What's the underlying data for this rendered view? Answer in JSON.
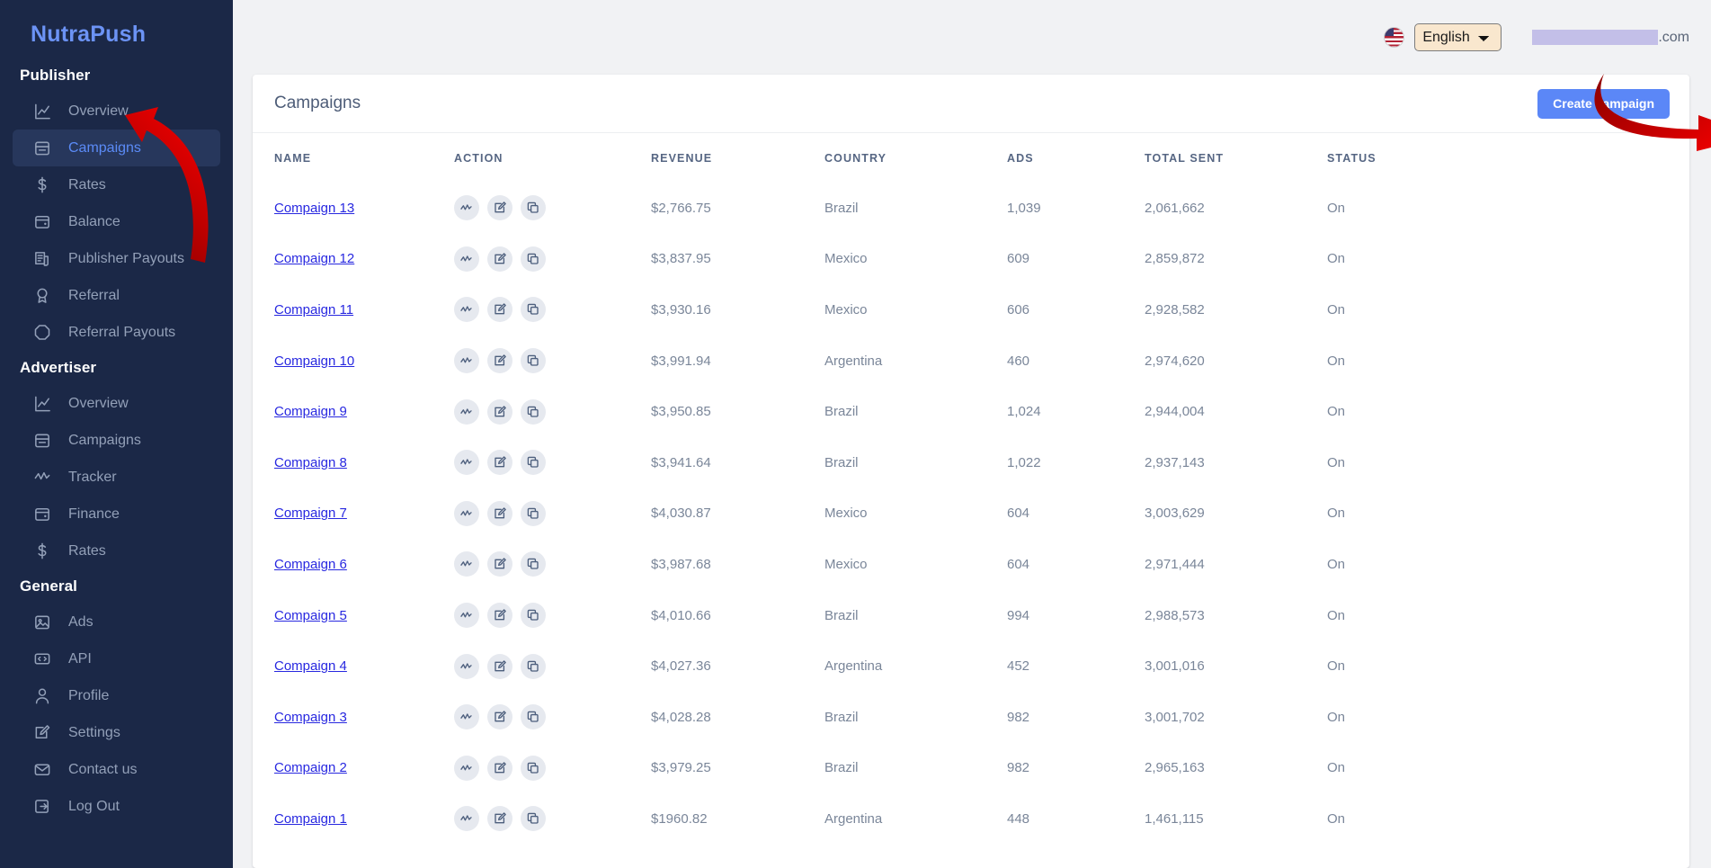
{
  "brand": {
    "name": "NutraPush"
  },
  "sidebar": {
    "sections": [
      {
        "title": "Publisher",
        "items": [
          {
            "label": "Overview",
            "icon": "chart-line-icon",
            "active": false
          },
          {
            "label": "Campaigns",
            "icon": "campaign-board-icon",
            "active": true
          },
          {
            "label": "Rates",
            "icon": "dollar-icon",
            "active": false
          },
          {
            "label": "Balance",
            "icon": "wallet-icon",
            "active": false
          },
          {
            "label": "Publisher Payouts",
            "icon": "invoice-icon",
            "active": false
          },
          {
            "label": "Referral",
            "icon": "award-icon",
            "active": false
          },
          {
            "label": "Referral Payouts",
            "icon": "badge-octagon-icon",
            "active": false
          }
        ]
      },
      {
        "title": "Advertiser",
        "items": [
          {
            "label": "Overview",
            "icon": "chart-line-icon",
            "active": false
          },
          {
            "label": "Campaigns",
            "icon": "campaign-board-icon",
            "active": false
          },
          {
            "label": "Tracker",
            "icon": "activity-icon",
            "active": false
          },
          {
            "label": "Finance",
            "icon": "wallet-icon",
            "active": false
          },
          {
            "label": "Rates",
            "icon": "dollar-icon",
            "active": false
          }
        ]
      },
      {
        "title": "General",
        "items": [
          {
            "label": "Ads",
            "icon": "image-icon",
            "active": false
          },
          {
            "label": "API",
            "icon": "code-icon",
            "active": false
          },
          {
            "label": "Profile",
            "icon": "user-icon",
            "active": false
          },
          {
            "label": "Settings",
            "icon": "pencil-icon",
            "active": false
          },
          {
            "label": "Contact us",
            "icon": "envelope-icon",
            "active": false
          },
          {
            "label": "Log Out",
            "icon": "logout-icon",
            "active": false
          }
        ]
      }
    ]
  },
  "topbar": {
    "flag": "us-flag-icon",
    "language_selected": "English",
    "language_options": [
      "English"
    ],
    "email_suffix": ".com"
  },
  "page": {
    "title": "Campaigns",
    "create_button": "Create campaign"
  },
  "table": {
    "columns": [
      "NAME",
      "ACTION",
      "REVENUE",
      "COUNTRY",
      "ADS",
      "TOTAL SENT",
      "STATUS"
    ],
    "action_icons": [
      "activity-icon",
      "edit-icon",
      "duplicate-icon"
    ],
    "rows": [
      {
        "name": "Compaign 13",
        "revenue": "$2,766.75",
        "country": "Brazil",
        "ads": "1,039",
        "total_sent": "2,061,662",
        "status": "On"
      },
      {
        "name": "Compaign 12",
        "revenue": "$3,837.95",
        "country": "Mexico",
        "ads": "609",
        "total_sent": "2,859,872",
        "status": "On"
      },
      {
        "name": "Compaign 11",
        "revenue": "$3,930.16",
        "country": "Mexico",
        "ads": "606",
        "total_sent": "2,928,582",
        "status": "On"
      },
      {
        "name": "Compaign 10",
        "revenue": "$3,991.94",
        "country": "Argentina",
        "ads": "460",
        "total_sent": "2,974,620",
        "status": "On"
      },
      {
        "name": "Compaign 9",
        "revenue": "$3,950.85",
        "country": "Brazil",
        "ads": "1,024",
        "total_sent": "2,944,004",
        "status": "On"
      },
      {
        "name": "Compaign 8",
        "revenue": "$3,941.64",
        "country": "Brazil",
        "ads": "1,022",
        "total_sent": "2,937,143",
        "status": "On"
      },
      {
        "name": "Compaign 7",
        "revenue": "$4,030.87",
        "country": "Mexico",
        "ads": "604",
        "total_sent": "3,003,629",
        "status": "On"
      },
      {
        "name": "Compaign 6",
        "revenue": "$3,987.68",
        "country": "Mexico",
        "ads": "604",
        "total_sent": "2,971,444",
        "status": "On"
      },
      {
        "name": "Compaign 5",
        "revenue": "$4,010.66",
        "country": "Brazil",
        "ads": "994",
        "total_sent": "2,988,573",
        "status": "On"
      },
      {
        "name": "Compaign 4",
        "revenue": "$4,027.36",
        "country": "Argentina",
        "ads": "452",
        "total_sent": "3,001,016",
        "status": "On"
      },
      {
        "name": "Compaign 3",
        "revenue": "$4,028.28",
        "country": "Brazil",
        "ads": "982",
        "total_sent": "3,001,702",
        "status": "On"
      },
      {
        "name": "Compaign 2",
        "revenue": "$3,979.25",
        "country": "Brazil",
        "ads": "982",
        "total_sent": "2,965,163",
        "status": "On"
      },
      {
        "name": "Compaign 1",
        "revenue": "$1960.82",
        "country": "Argentina",
        "ads": "448",
        "total_sent": "1,461,115",
        "status": "On"
      }
    ]
  },
  "annotations": {
    "arrow_color": "#cc0000",
    "arrows": [
      {
        "name": "arrow-to-campaigns-nav",
        "points_to": "Campaigns"
      },
      {
        "name": "arrow-to-create-campaign",
        "points_to": "Create campaign"
      }
    ]
  },
  "colors": {
    "sidebar_bg": "#1b2847",
    "sidebar_active_bg": "#27375c",
    "accent_blue": "#5b87f7",
    "brand_blue": "#6c93f5",
    "link_blue": "#2828e0",
    "page_bg": "#f1f2f4",
    "lang_select_bg": "#f9e7ce"
  }
}
